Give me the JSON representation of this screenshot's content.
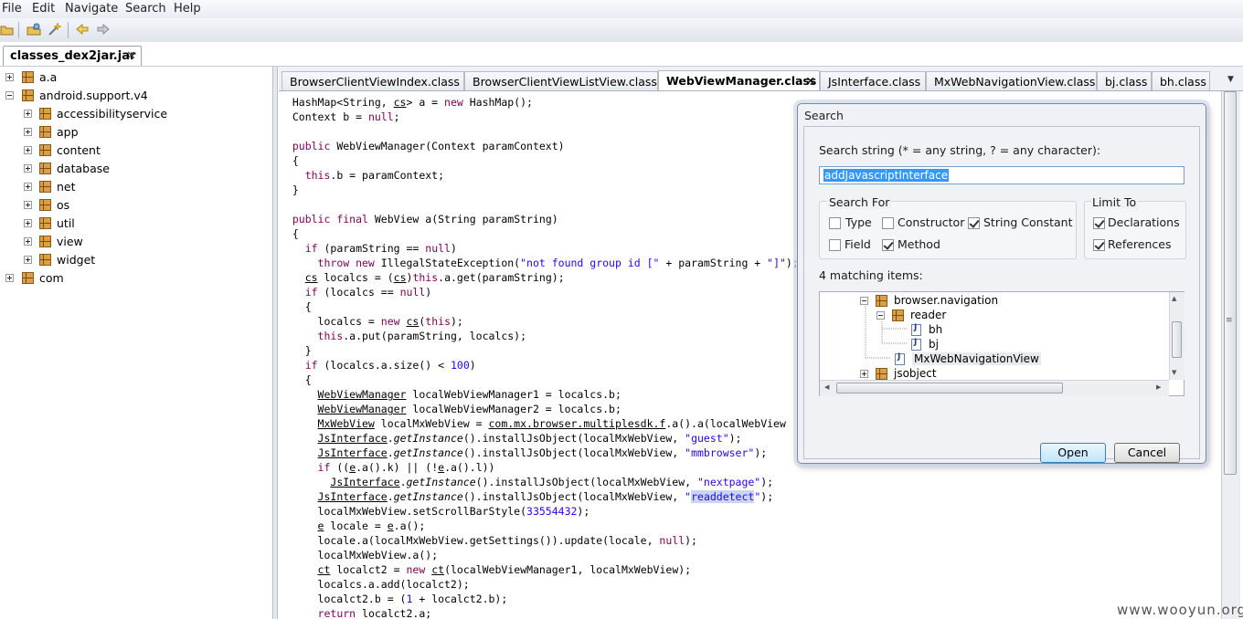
{
  "menu": [
    "File",
    "Edit",
    "Navigate",
    "Search",
    "Help"
  ],
  "file_tab": {
    "label": "classes_dex2jar.jar"
  },
  "tree": [
    {
      "label": "a.a",
      "level": 0,
      "expanded": false
    },
    {
      "label": "android.support.v4",
      "level": 0,
      "expanded": true
    },
    {
      "label": "accessibilityservice",
      "level": 1,
      "expanded": false
    },
    {
      "label": "app",
      "level": 1,
      "expanded": false
    },
    {
      "label": "content",
      "level": 1,
      "expanded": false
    },
    {
      "label": "database",
      "level": 1,
      "expanded": false
    },
    {
      "label": "net",
      "level": 1,
      "expanded": false
    },
    {
      "label": "os",
      "level": 1,
      "expanded": false
    },
    {
      "label": "util",
      "level": 1,
      "expanded": false
    },
    {
      "label": "view",
      "level": 1,
      "expanded": false
    },
    {
      "label": "widget",
      "level": 1,
      "expanded": false
    },
    {
      "label": "com",
      "level": 0,
      "expanded": false
    }
  ],
  "editor_tabs": [
    {
      "label": "BrowserClientViewIndex.class",
      "active": false
    },
    {
      "label": "BrowserClientViewListView.class",
      "active": false
    },
    {
      "label": "WebViewManager.class",
      "active": true
    },
    {
      "label": "JsInterface.class",
      "active": false
    },
    {
      "label": "MxWebNavigationView.class",
      "active": false
    },
    {
      "label": "bj.class",
      "active": false
    },
    {
      "label": "bh.class",
      "active": false
    }
  ],
  "code_lines": [
    "  HashMap<String, cs> a = new HashMap();",
    "  Context b = null;",
    "",
    "  public WebViewManager(Context paramContext)",
    "  {",
    "    this.b = paramContext;",
    "  }",
    "",
    "  public final WebView a(String paramString)",
    "  {",
    "    if (paramString == null)",
    "      throw new IllegalStateException(\"not found group id [\" + paramString + \"]\");",
    "    cs localcs = (cs)this.a.get(paramString);",
    "    if (localcs == null)",
    "    {",
    "      localcs = new cs(this);",
    "      this.a.put(paramString, localcs);",
    "    }",
    "    if (localcs.a.size() < 100)",
    "    {",
    "      WebViewManager localWebViewManager1 = localcs.b;",
    "      WebViewManager localWebViewManager2 = localcs.b;",
    "      MxWebView localMxWebView = com.mx.browser.multiplesdk.f.a().a(localWebView",
    "      JsInterface.getInstance().installJsObject(localMxWebView, \"guest\");",
    "      JsInterface.getInstance().installJsObject(localMxWebView, \"mmbrowser\");",
    "      if ((e.a().k) || (!e.a().l))",
    "        JsInterface.getInstance().installJsObject(localMxWebView, \"nextpage\");",
    "      JsInterface.getInstance().installJsObject(localMxWebView, \"readdetect\");",
    "      localMxWebView.setScrollBarStyle(33554432);",
    "      e locale = e.a();",
    "      locale.a(localMxWebView.getSettings()).update(locale, null);",
    "      localMxWebView.a();",
    "      ct localct2 = new ct(localWebViewManager1, localMxWebView);",
    "      localcs.a.add(localct2);",
    "      localct2.b = (1 + localct2.b);",
    "      return localct2.a;"
  ],
  "dialog": {
    "title": "Search",
    "search_label": "Search string (* = any string, ? = any character):",
    "search_value": "addJavascriptInterface",
    "search_for_label": "Search For",
    "limit_to_label": "Limit To",
    "options": {
      "type": {
        "label": "Type",
        "checked": false
      },
      "constructor": {
        "label": "Constructor",
        "checked": false
      },
      "string_constant": {
        "label": "String Constant",
        "checked": true
      },
      "field": {
        "label": "Field",
        "checked": false
      },
      "method": {
        "label": "Method",
        "checked": true
      },
      "declarations": {
        "label": "Declarations",
        "checked": true
      },
      "references": {
        "label": "References",
        "checked": true
      }
    },
    "matching_label": "4 matching items:",
    "results": [
      {
        "label": "browser.navigation",
        "kind": "package"
      },
      {
        "label": "reader",
        "kind": "package"
      },
      {
        "label": "bh",
        "kind": "class"
      },
      {
        "label": "bj",
        "kind": "class"
      },
      {
        "label": "MxWebNavigationView",
        "kind": "class"
      },
      {
        "label": "jsobject",
        "kind": "package"
      }
    ],
    "open_label": "Open",
    "cancel_label": "Cancel"
  },
  "watermark": "www.wooyun.org"
}
